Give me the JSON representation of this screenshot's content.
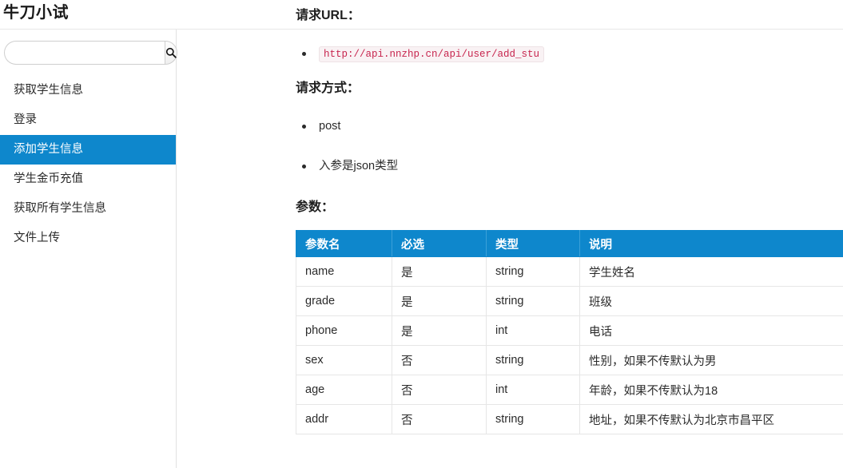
{
  "site": {
    "title": "牛刀小试"
  },
  "search": {
    "value": "",
    "placeholder": "",
    "icon": "search-icon"
  },
  "sidebar": {
    "items": [
      {
        "label": "获取学生信息",
        "active": false
      },
      {
        "label": "登录",
        "active": false
      },
      {
        "label": "添加学生信息",
        "active": true
      },
      {
        "label": "学生金币充值",
        "active": false
      },
      {
        "label": "获取所有学生信息",
        "active": false
      },
      {
        "label": "文件上传",
        "active": false
      }
    ]
  },
  "doc": {
    "url_heading": "请求URL：",
    "url_items": [
      "http://api.nnzhp.cn/api/user/add_stu"
    ],
    "method_heading": "请求方式：",
    "method_items": [
      "post",
      "入参是json类型"
    ],
    "params_heading": "参数：",
    "table": {
      "headers": [
        "参数名",
        "必选",
        "类型",
        "说明"
      ],
      "rows": [
        [
          "name",
          "是",
          "string",
          "学生姓名"
        ],
        [
          "grade",
          "是",
          "string",
          "班级"
        ],
        [
          "phone",
          "是",
          "int",
          "电话"
        ],
        [
          "sex",
          "否",
          "string",
          "性别，如果不传默认为男"
        ],
        [
          "age",
          "否",
          "int",
          "年龄，如果不传默认为18"
        ],
        [
          "addr",
          "否",
          "string",
          "地址，如果不传默认为北京市昌平区"
        ]
      ]
    }
  },
  "colors": {
    "accent": "#0e87cc",
    "code_text": "#c7254e",
    "code_bg": "#f9f2f4"
  }
}
